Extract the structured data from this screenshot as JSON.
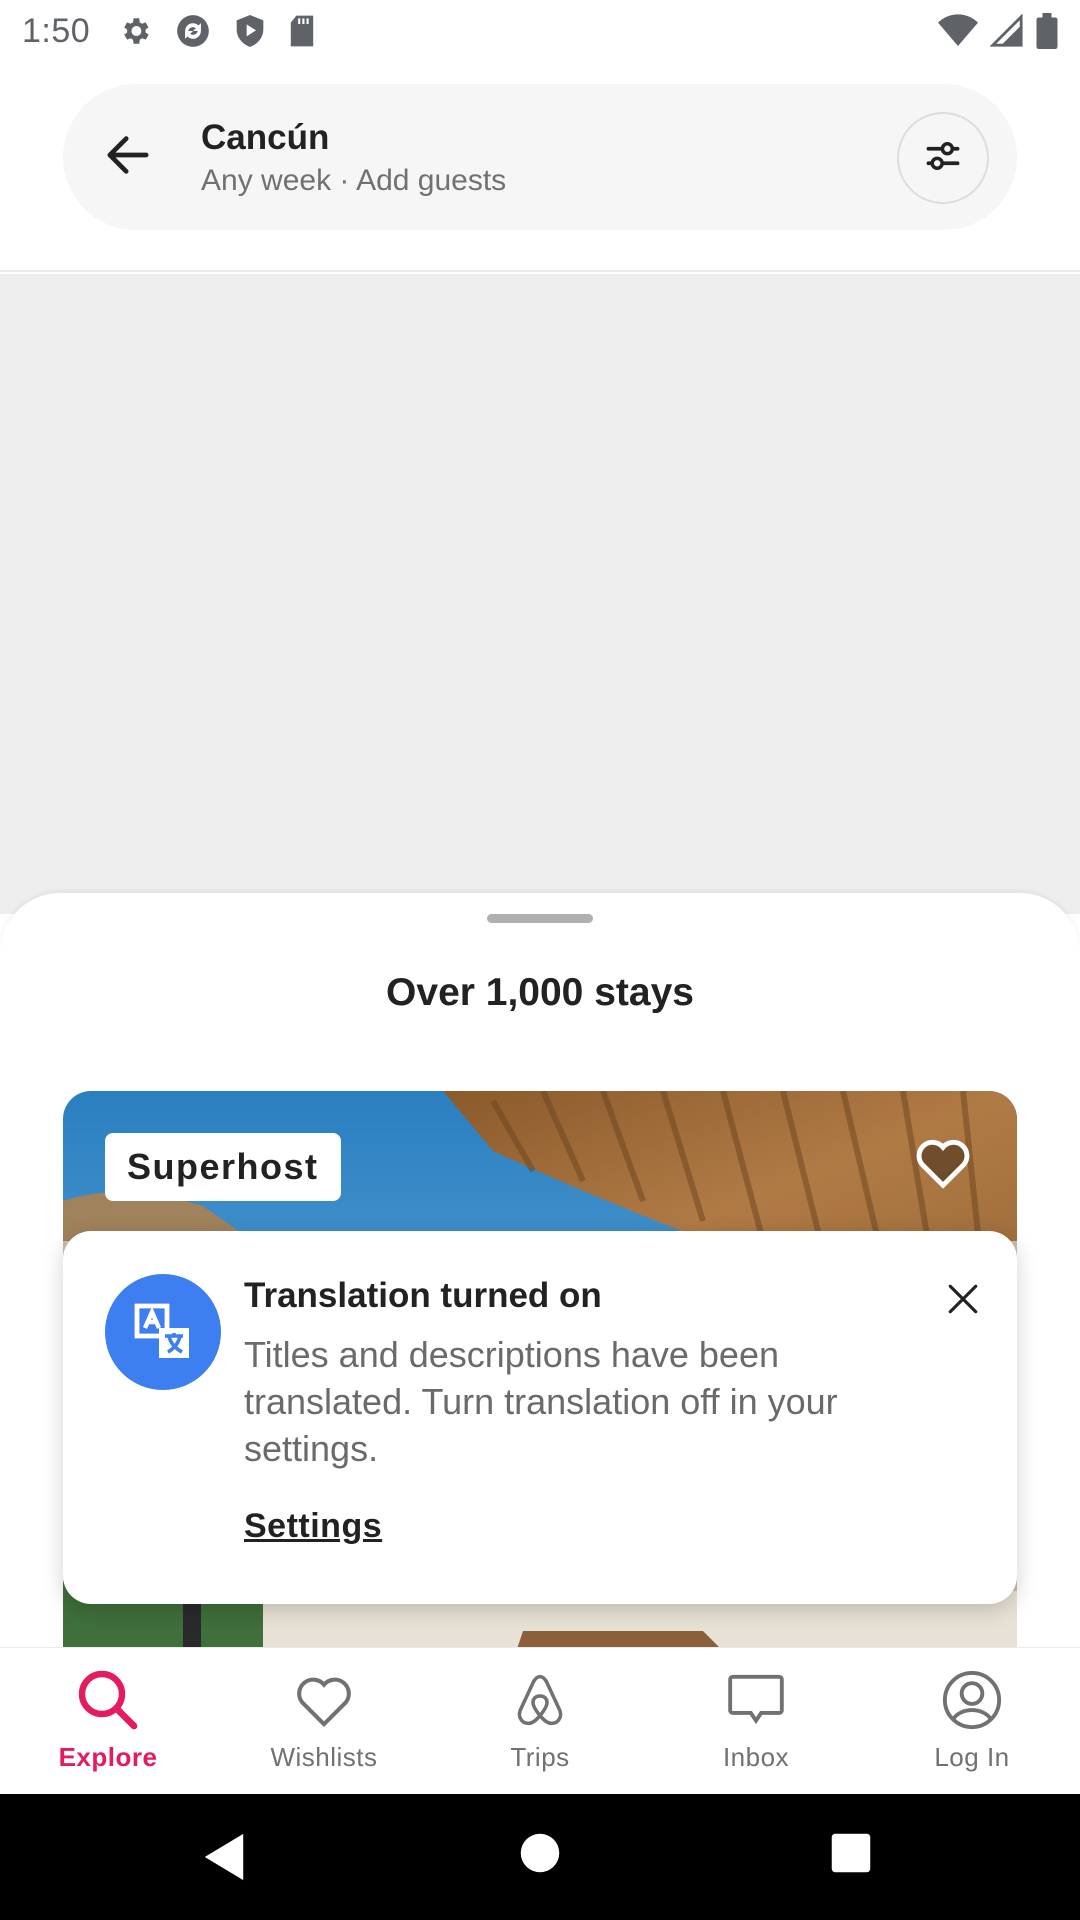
{
  "status_bar": {
    "time": "1:50",
    "left_icons": [
      "settings-icon",
      "sync-icon",
      "shield-play-icon",
      "sd-card-icon"
    ],
    "right_icons": [
      "wifi-icon",
      "signal-icon",
      "battery-icon"
    ]
  },
  "search": {
    "title": "Cancún",
    "subtitle": "Any week · Add guests",
    "back_icon": "arrow-left-icon",
    "filter_icon": "filter-sliders-icon"
  },
  "sheet": {
    "title": "Over 1,000 stays"
  },
  "listing": {
    "badge": "Superhost",
    "wishlist_icon": "heart-outline-icon"
  },
  "toast": {
    "icon": "translate-icon",
    "title": "Translation turned on",
    "body": "Titles and descriptions have been translated. Turn translation off in your settings.",
    "link": "Settings",
    "close_icon": "close-icon"
  },
  "bottom_nav": {
    "items": [
      {
        "label": "Explore",
        "icon": "search-icon",
        "active": true
      },
      {
        "label": "Wishlists",
        "icon": "heart-icon",
        "active": false
      },
      {
        "label": "Trips",
        "icon": "airbnb-logo-icon",
        "active": false
      },
      {
        "label": "Inbox",
        "icon": "message-icon",
        "active": false
      },
      {
        "label": "Log In",
        "icon": "profile-icon",
        "active": false
      }
    ]
  },
  "colors": {
    "accent": "#e31c5f",
    "toast_icon_bg": "#3d7ef0",
    "map_bg": "#eeeeee"
  }
}
